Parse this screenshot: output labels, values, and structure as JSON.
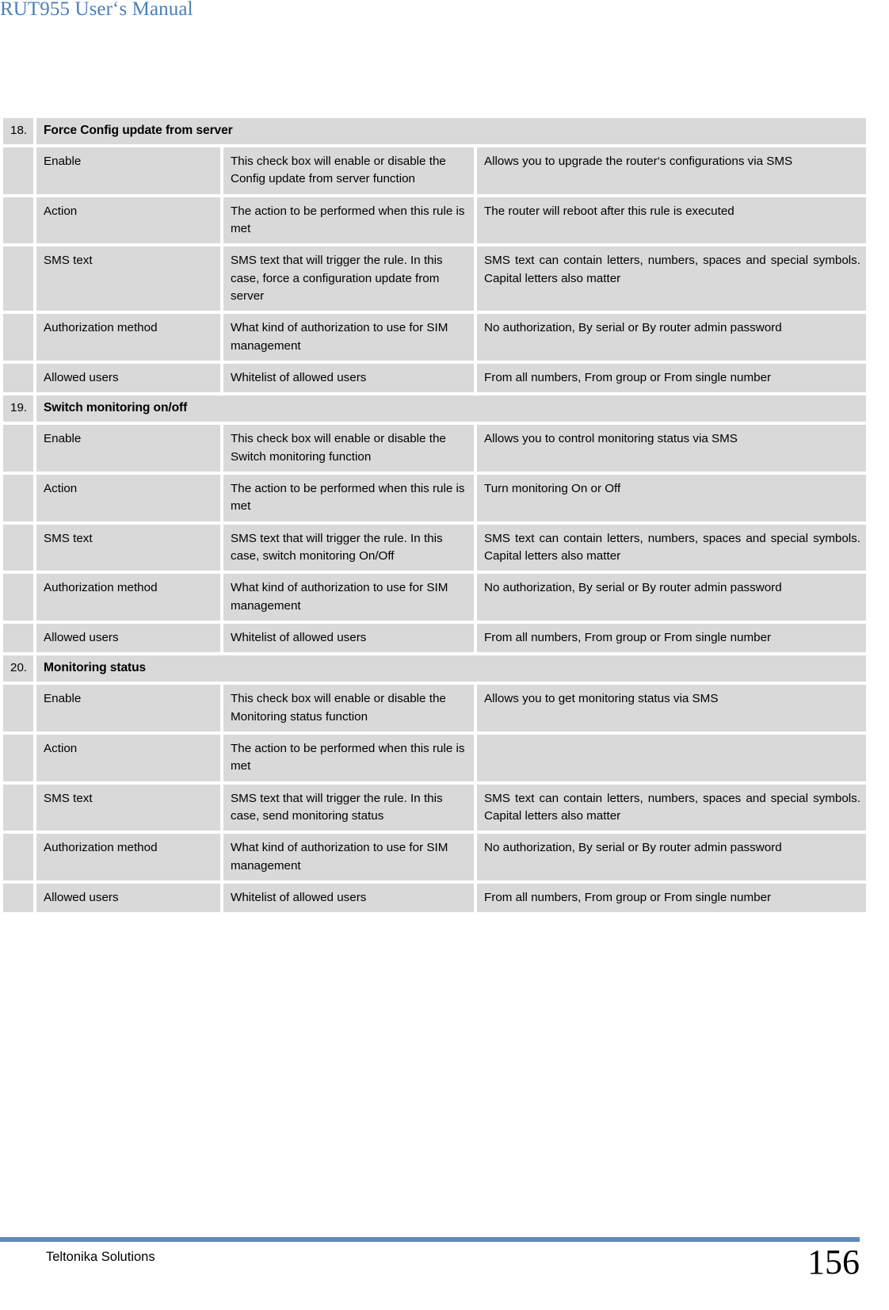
{
  "header": {
    "title": "RUT955 User‘s Manual",
    "title_color": "#4a7ebb"
  },
  "footer": {
    "company": "Teltonika Solutions",
    "page_number": "156",
    "rule_color": "#5b8ac4"
  },
  "table": {
    "cell_background": "#d9d9d9",
    "sections": [
      {
        "number": "18.",
        "title": "Force Config update from server",
        "rows": [
          {
            "name": "Enable",
            "description": "This check box will enable or disable the Config update from server function",
            "value": "Allows you to upgrade the router‘s configurations via SMS"
          },
          {
            "name": "Action",
            "description": "The action to be performed when this rule is met",
            "value": "The router will reboot after this rule is executed"
          },
          {
            "name": "SMS text",
            "description": "SMS text that will trigger the rule. In this case, force a configuration update from server",
            "value": "SMS text can contain letters, numbers, spaces and special symbols. Capital letters also matter"
          },
          {
            "name": "Authorization method",
            "description": "What kind of authorization to use for SIM management",
            "value": "No authorization, By serial or By router admin password"
          },
          {
            "name": "Allowed users",
            "description": "Whitelist of allowed users",
            "value": "From all numbers, From group or From single number"
          }
        ]
      },
      {
        "number": "19.",
        "title": "Switch monitoring on/off",
        "rows": [
          {
            "name": "Enable",
            "description": "This check box will enable or disable the Switch monitoring function",
            "value": "Allows you to control monitoring status via SMS"
          },
          {
            "name": "Action",
            "description": "The action to be performed when this rule is met",
            "value": "Turn monitoring On or Off"
          },
          {
            "name": "SMS text",
            "description": "SMS text that will trigger the rule. In this case, switch monitoring On/Off",
            "value": "SMS text can contain letters, numbers, spaces and special symbols. Capital letters also matter"
          },
          {
            "name": "Authorization method",
            "description": "What kind of authorization to use for SIM management",
            "value": "No authorization, By serial or By router admin password"
          },
          {
            "name": "Allowed users",
            "description": "Whitelist of allowed users",
            "value": "From all numbers, From group or From single number"
          }
        ]
      },
      {
        "number": "20.",
        "title": "Monitoring status",
        "rows": [
          {
            "name": "Enable",
            "description": "This check box will enable or disable the Monitoring status function",
            "value": "Allows you to get monitoring status via SMS"
          },
          {
            "name": "Action",
            "description": "The action to be performed when this rule is met",
            "value": ""
          },
          {
            "name": "SMS text",
            "description": "SMS text that will trigger the rule. In this case, send monitoring status",
            "value": "SMS text can contain letters, numbers, spaces and special symbols. Capital letters also matter"
          },
          {
            "name": "Authorization method",
            "description": "What kind of authorization to use for SIM management",
            "value": "No authorization, By serial or By router admin password"
          },
          {
            "name": "Allowed users",
            "description": "Whitelist of allowed users",
            "value": "From all numbers, From group or From single number"
          }
        ]
      }
    ]
  }
}
